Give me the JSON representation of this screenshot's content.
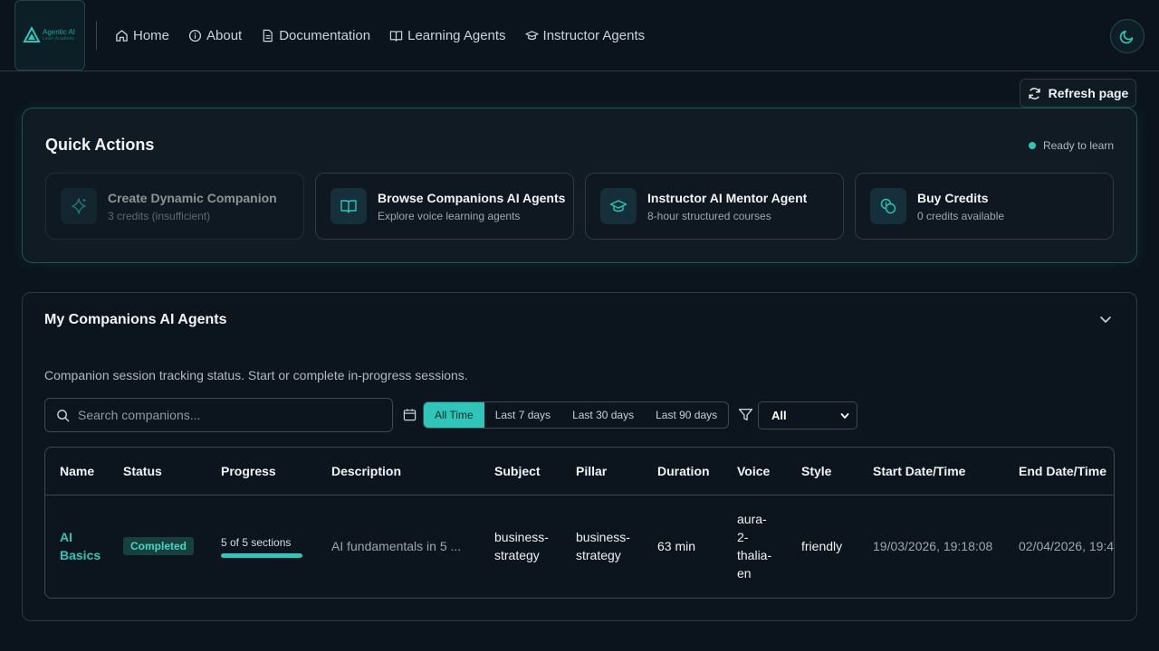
{
  "header": {
    "logo_line1": "Agentic AI",
    "logo_line2": "Learn Academy",
    "nav": [
      {
        "label": "Home",
        "icon": "home-icon"
      },
      {
        "label": "About",
        "icon": "info-icon"
      },
      {
        "label": "Documentation",
        "icon": "document-icon"
      },
      {
        "label": "Learning Agents",
        "icon": "book-icon"
      },
      {
        "label": "Instructor Agents",
        "icon": "graduation-cap-icon"
      }
    ],
    "theme_icon": "moon-icon"
  },
  "refresh_label": "Refresh page",
  "quick_actions": {
    "title": "Quick Actions",
    "status": "Ready to learn",
    "cards": [
      {
        "title": "Create Dynamic Companion",
        "subtitle": "3 credits (insufficient)",
        "icon": "sparkle-icon",
        "disabled": true
      },
      {
        "title": "Browse Companions AI Agents",
        "subtitle": "Explore voice learning agents",
        "icon": "book-open-icon"
      },
      {
        "title": "Instructor AI Mentor Agent",
        "subtitle": "8-hour structured courses",
        "icon": "graduation-cap-icon"
      },
      {
        "title": "Buy Credits",
        "subtitle": "0 credits available",
        "icon": "coins-icon"
      }
    ]
  },
  "companions": {
    "title": "My Companions AI Agents",
    "description": "Companion session tracking status. Start or complete in-progress sessions.",
    "search_placeholder": "Search companions...",
    "ranges": [
      "All Time",
      "Last 7 days",
      "Last 30 days",
      "Last 90 days"
    ],
    "active_range": "All Time",
    "filter_value": "All",
    "columns": [
      "Name",
      "Status",
      "Progress",
      "Description",
      "Subject",
      "Pillar",
      "Duration",
      "Voice",
      "Style",
      "Start Date/Time",
      "End Date/Time"
    ],
    "rows": [
      {
        "name_line1": "AI",
        "name_line2": "Basics",
        "status": "Completed",
        "progress_text": "5 of 5 sections",
        "progress_fraction": 1.0,
        "description": "AI fundamentals in 5 ...",
        "subject_line1": "business-",
        "subject_line2": "strategy",
        "pillar_line1": "business-",
        "pillar_line2": "strategy",
        "duration": "63 min",
        "voice_lines": [
          "aura-",
          "2-",
          "thalia-",
          "en"
        ],
        "style": "friendly",
        "start": "19/03/2026, 19:18:08",
        "end": "02/04/2026, 19:4"
      }
    ]
  },
  "colors": {
    "accent": "#2fc6b9",
    "background": "#0b141c"
  }
}
